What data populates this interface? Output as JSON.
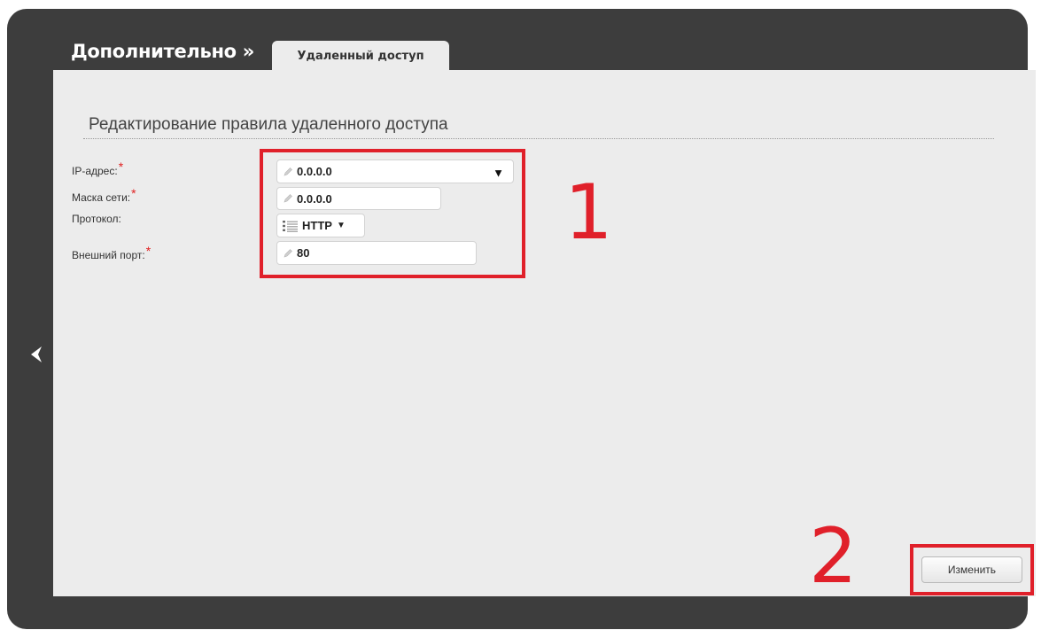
{
  "header": {
    "breadcrumb": "Дополнительно »",
    "active_tab": "Удаленный доступ"
  },
  "form": {
    "title": "Редактирование правила удаленного доступа",
    "required_mark": "*",
    "fields": {
      "ip": {
        "label": "IP-адрес:",
        "value": "0.0.0.0"
      },
      "mask": {
        "label": "Маска сети:",
        "value": "0.0.0.0"
      },
      "protocol": {
        "label": "Протокол:",
        "value": "HTTP"
      },
      "port": {
        "label": "Внешний порт:",
        "value": "80"
      }
    },
    "submit_label": "Изменить"
  },
  "annotations": {
    "one": "1",
    "two": "2",
    "color": "#e0202a"
  },
  "icons": [
    "back-arrow-icon",
    "pencil-icon",
    "dropdown-caret-icon",
    "list-icon"
  ]
}
